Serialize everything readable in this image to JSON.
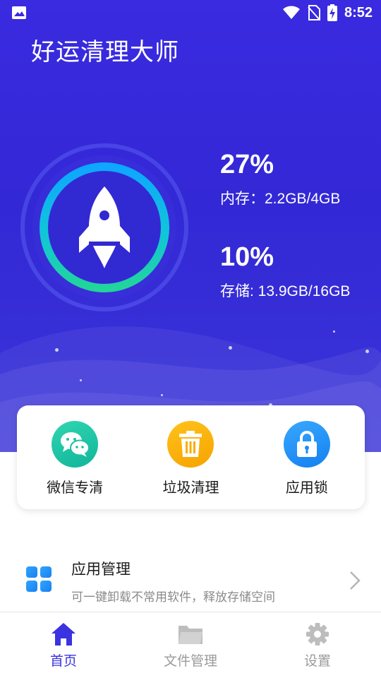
{
  "status_bar": {
    "time": "8:52",
    "icons": [
      "image-icon",
      "wifi-icon",
      "no-sim-icon",
      "battery-charging-icon"
    ]
  },
  "header": {
    "app_title": "好运清理大师"
  },
  "memory": {
    "percent": "27%",
    "label": "内存：2.2GB/4GB",
    "usage_fraction": 0.27
  },
  "storage": {
    "percent": "10%",
    "label": "存储: 13.9GB/16GB",
    "usage_fraction": 0.1
  },
  "tools": [
    {
      "label": "微信专清",
      "icon": "wechat-icon",
      "color": "#1fc4a4"
    },
    {
      "label": "垃圾清理",
      "icon": "trash-icon",
      "color": "#fbb40c"
    },
    {
      "label": "应用锁",
      "icon": "lock-icon",
      "color": "#2394f8"
    }
  ],
  "app_manage": {
    "title": "应用管理",
    "description": "可一键卸载不常用软件，释放存储空间",
    "icon": "apps-grid-icon"
  },
  "tabbar": {
    "tabs": [
      {
        "label": "首页",
        "icon": "home-icon",
        "active": true
      },
      {
        "label": "文件管理",
        "icon": "folder-icon",
        "active": false
      },
      {
        "label": "设置",
        "icon": "gear-icon",
        "active": false
      }
    ]
  },
  "colors": {
    "hero_bg": "#3a2ae0",
    "accent": "#3a33e0",
    "ring_start": "#14c8d8",
    "ring_end": "#22d59a"
  }
}
